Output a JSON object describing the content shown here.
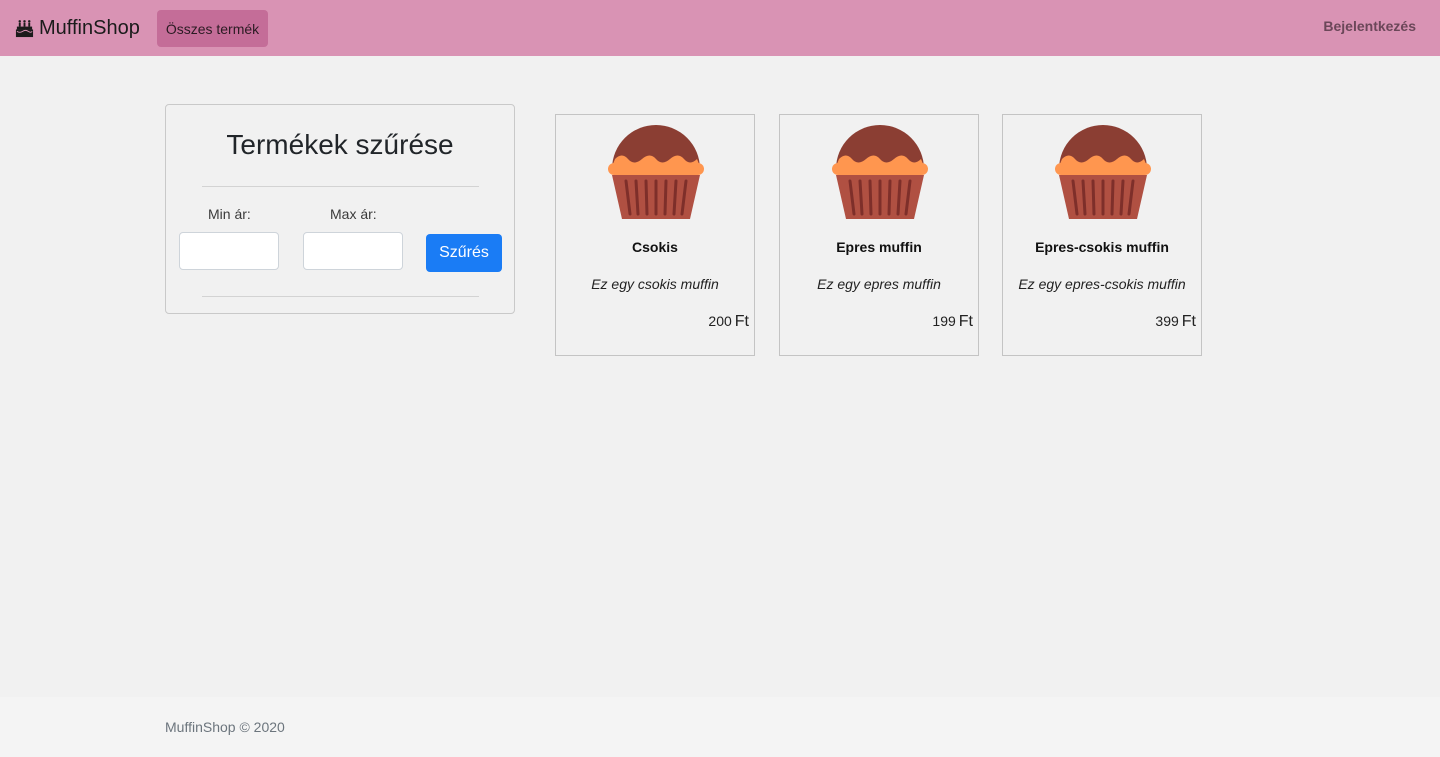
{
  "navbar": {
    "brand": "MuffinShop",
    "brand_icon": "birthday-cake-icon",
    "all_products": "Összes termék",
    "login": "Bejelentkezés"
  },
  "filter": {
    "title": "Termékek szűrése",
    "min_label": "Min ár:",
    "max_label": "Max ár:",
    "min_value": "",
    "max_value": "",
    "button": "Szűrés"
  },
  "products": [
    {
      "name": "Csokis",
      "description": "Ez egy csokis muffin",
      "price": "200",
      "currency": "Ft",
      "icon": "muffin-icon"
    },
    {
      "name": "Epres muffin",
      "description": "Ez egy epres muffin",
      "price": "199",
      "currency": "Ft",
      "icon": "muffin-icon"
    },
    {
      "name": "Epres-csokis muffin",
      "description": "Ez egy epres-csokis muffin",
      "price": "399",
      "currency": "Ft",
      "icon": "muffin-icon"
    }
  ],
  "footer": {
    "text": "MuffinShop © 2020"
  },
  "colors": {
    "navbar": "#d993b4",
    "nav_active": "#c46d98",
    "primary_button": "#1a7cf5",
    "muffin_top": "#8b3e33",
    "muffin_cream": "#ff964f",
    "muffin_wrapper": "#b05042"
  }
}
